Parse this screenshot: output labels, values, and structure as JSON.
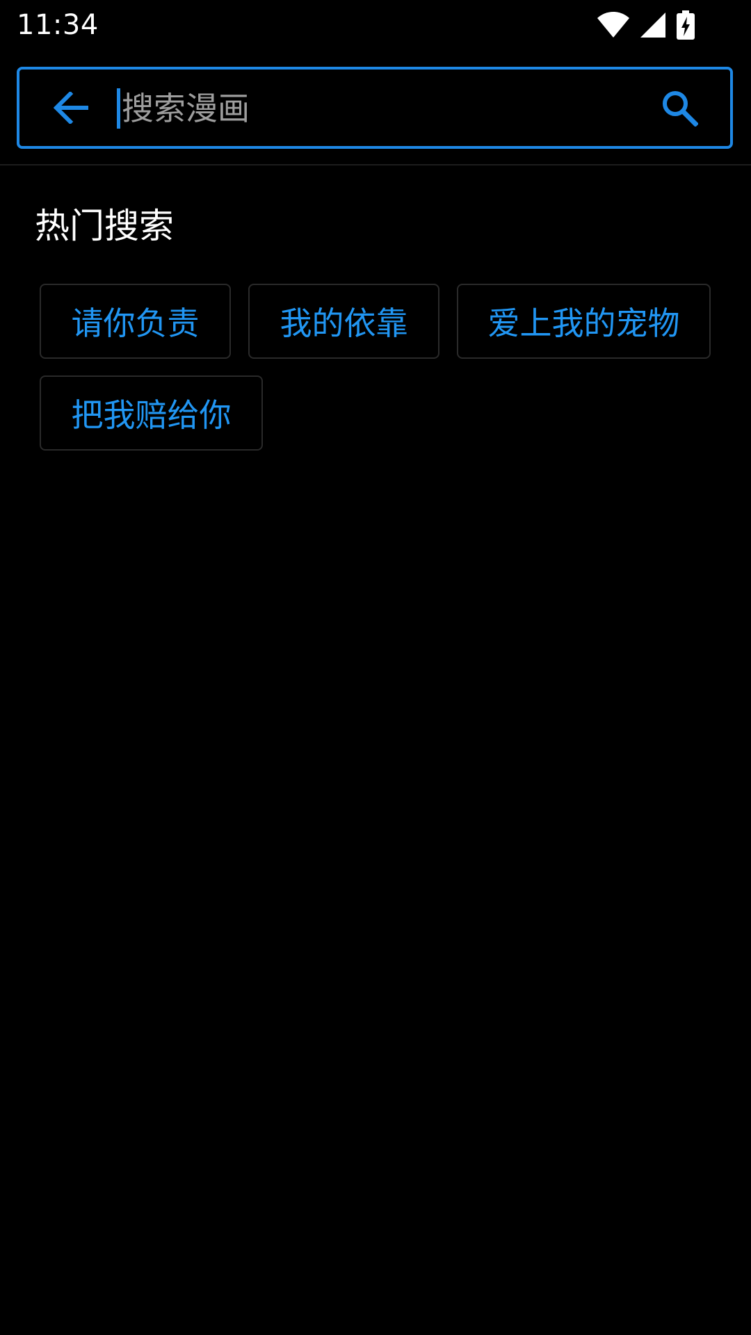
{
  "status_bar": {
    "time": "11:34",
    "icons": [
      "wifi-icon",
      "signal-icon",
      "battery-charging-icon"
    ]
  },
  "search": {
    "placeholder": "搜索漫画",
    "value": ""
  },
  "hot_search": {
    "title": "热门搜索",
    "tags": [
      {
        "label": "请你负责"
      },
      {
        "label": "我的依靠"
      },
      {
        "label": "爱上我的宠物"
      },
      {
        "label": "把我赔给你"
      }
    ]
  },
  "colors": {
    "accent": "#1e88e5",
    "tag_text": "#2196f3",
    "background": "#000000",
    "placeholder": "#9e9e9e"
  }
}
